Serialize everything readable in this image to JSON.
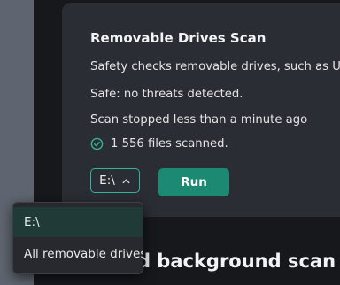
{
  "card": {
    "title": "Removable Drives Scan",
    "description": "Safety checks removable drives, such as USB",
    "status": "Safe: no threats detected.",
    "last_scan": "Scan stopped less than a minute ago",
    "files_scanned": "1 556 files scanned."
  },
  "controls": {
    "drive_value": "E:\\",
    "run_label": "Run"
  },
  "dropdown": {
    "options": [
      "E:\\",
      "All removable drives"
    ],
    "selected_index": 0
  },
  "next_section": {
    "heading_fragment": "nd background scan"
  },
  "colors": {
    "accent": "#34b59a",
    "button": "#1c8a72",
    "card": "#2a2d33",
    "background": "#17181c"
  },
  "icons": {
    "files_status": "check-circle-icon",
    "select_toggle": "chevron-up-icon"
  }
}
